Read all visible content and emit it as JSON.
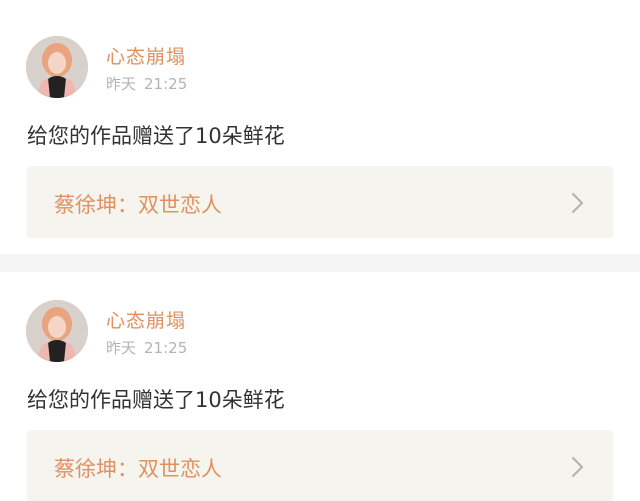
{
  "notifications": [
    {
      "username": "心态崩塌",
      "day": "昨天",
      "time": "21:25",
      "message": "给您的作品赠送了10朵鲜花",
      "work_title": "蔡徐坤：双世恋人"
    },
    {
      "username": "心态崩塌",
      "day": "昨天",
      "time": "21:25",
      "message": "给您的作品赠送了10朵鲜花",
      "work_title": "蔡徐坤：双世恋人"
    }
  ],
  "icons": {
    "chevron": "chevron-right-icon",
    "avatar": "user-avatar"
  },
  "colors": {
    "accent": "#e0915f",
    "link_background": "#f5f4ee",
    "muted_text": "#b4b4b4"
  }
}
